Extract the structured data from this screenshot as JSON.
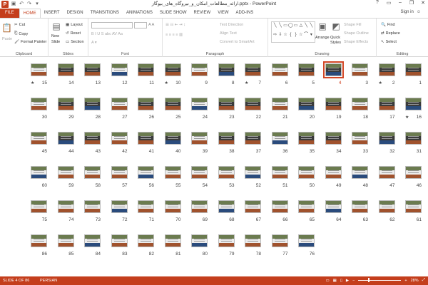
{
  "app": {
    "logo_letter": "P",
    "title": "ارائه_مطالعات_امکان_و_نیروگاه_های_بیوگاز.pptx - PowerPoint",
    "qat": [
      "save-icon",
      "undo-icon",
      "redo-icon",
      "customize-icon"
    ],
    "window_controls": [
      "?",
      "▭",
      "–",
      "❐",
      "✕"
    ],
    "sign_in": "Sign in"
  },
  "tabs": [
    {
      "label": "FILE",
      "kind": "file"
    },
    {
      "label": "HOME",
      "kind": "active"
    },
    {
      "label": "INSERT"
    },
    {
      "label": "DESIGN"
    },
    {
      "label": "TRANSITIONS"
    },
    {
      "label": "ANIMATIONS"
    },
    {
      "label": "SLIDE SHOW"
    },
    {
      "label": "REVIEW"
    },
    {
      "label": "VIEW"
    },
    {
      "label": "ADD-INS"
    }
  ],
  "ribbon": {
    "clipboard": {
      "label": "Clipboard",
      "paste": "Paste",
      "cut": "Cut",
      "copy": "Copy",
      "format_painter": "Format Painter"
    },
    "slides": {
      "label": "Slides",
      "new_slide": "New",
      "new_slide2": "Slide",
      "layout": "Layout",
      "reset": "Reset",
      "section": "Section"
    },
    "font": {
      "label": "Font"
    },
    "paragraph": {
      "label": "Paragraph",
      "text_direction": "Text Direction",
      "align_text": "Align Text",
      "convert": "Convert to SmartArt"
    },
    "drawing": {
      "label": "Drawing",
      "arrange": "Arrange",
      "quick_styles": "Quick",
      "quick_styles2": "Styles",
      "shape_fill": "Shape Fill",
      "shape_outline": "Shape Outline",
      "shape_effects": "Shape Effects"
    },
    "editing": {
      "label": "Editing",
      "find": "Find",
      "replace": "Replace",
      "select": "Select"
    }
  },
  "slides": {
    "selected": 4,
    "starred": [
      15,
      10,
      7,
      2,
      16
    ],
    "rows": [
      [
        15,
        14,
        13,
        12,
        11,
        10,
        9,
        8,
        7,
        6,
        5,
        4,
        3,
        2,
        1
      ],
      [
        30,
        29,
        28,
        27,
        26,
        25,
        24,
        23,
        22,
        21,
        20,
        19,
        18,
        17,
        16
      ],
      [
        45,
        44,
        43,
        42,
        41,
        40,
        39,
        38,
        37,
        36,
        35,
        34,
        33,
        32,
        31
      ],
      [
        60,
        59,
        58,
        57,
        56,
        55,
        54,
        53,
        52,
        51,
        50,
        49,
        48,
        47,
        46
      ],
      [
        75,
        74,
        73,
        72,
        71,
        70,
        69,
        68,
        67,
        66,
        65,
        64,
        63,
        62,
        61
      ],
      [
        86,
        85,
        84,
        83,
        82,
        81,
        80,
        79,
        78,
        77,
        76
      ]
    ]
  },
  "status": {
    "slide_info": "SLIDE 4 OF 86",
    "language": "PERSIAN",
    "zoom": "28%",
    "zoom_minus": "−",
    "zoom_plus": "+"
  }
}
